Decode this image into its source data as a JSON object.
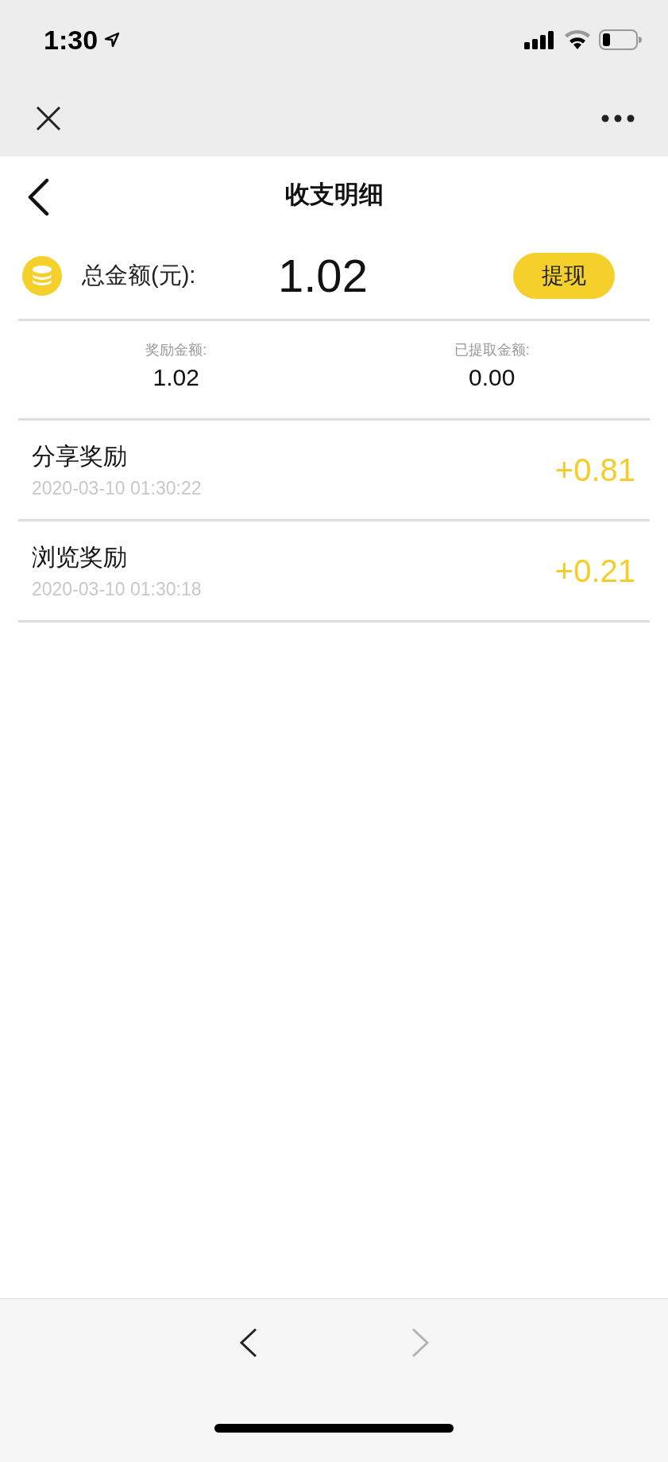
{
  "status_bar": {
    "time": "1:30"
  },
  "header": {
    "title": "收支明细"
  },
  "total": {
    "label": "总金额(元):",
    "amount": "1.02",
    "button": "提现"
  },
  "summary": [
    {
      "label": "奖励金额:",
      "value": "1.02"
    },
    {
      "label": "已提取金额:",
      "value": "0.00"
    }
  ],
  "records": [
    {
      "title": "分享奖励",
      "time": "2020-03-10 01:30:22",
      "amount": "+0.81"
    },
    {
      "title": "浏览奖励",
      "time": "2020-03-10 01:30:18",
      "amount": "+0.21"
    }
  ],
  "toolbar": [
    {
      "kind": "back",
      "disabled": false
    },
    {
      "kind": "forward",
      "disabled": true
    }
  ]
}
